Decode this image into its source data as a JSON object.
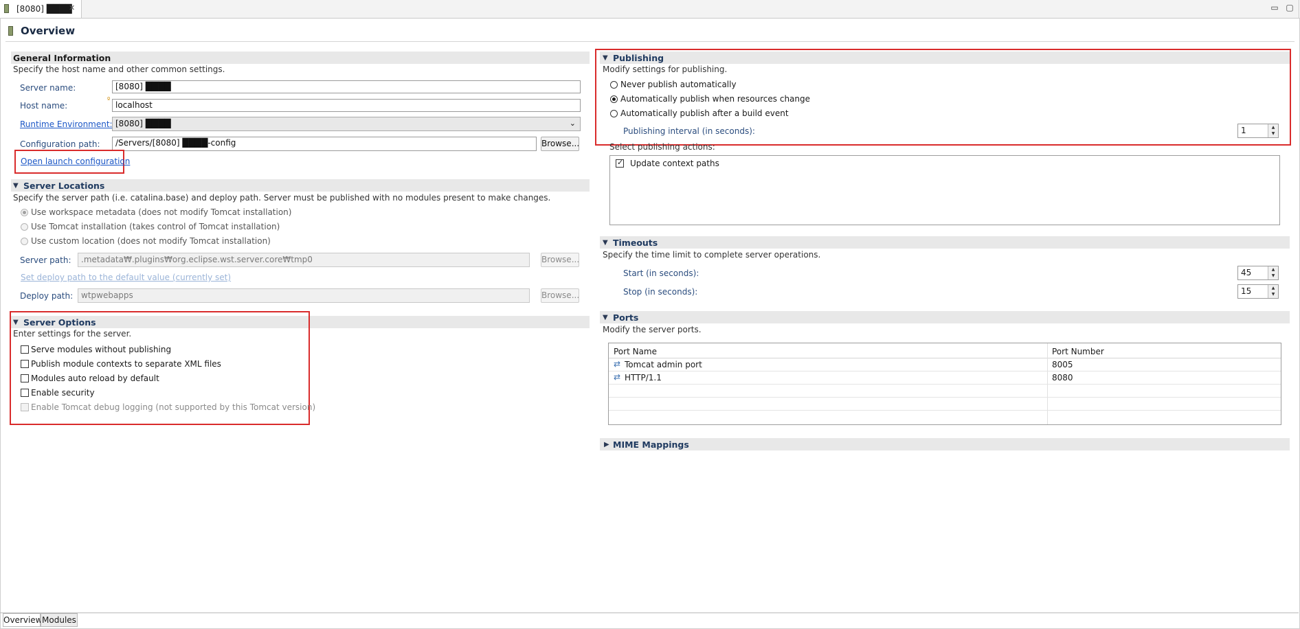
{
  "editor_tab": {
    "title": "[8080] ████"
  },
  "header": {
    "title": "Overview"
  },
  "general": {
    "title": "General Information",
    "description": "Specify the host name and other common settings.",
    "server_name_label": "Server name:",
    "server_name_value": "[8080] ████",
    "host_name_label": "Host name:",
    "host_name_value": "localhost",
    "runtime_label": "Runtime Environment:",
    "runtime_value": "[8080] ████",
    "config_label": "Configuration path:",
    "config_value": "/Servers/[8080] ████-config",
    "browse_label": "Browse...",
    "open_launch": "Open launch configuration"
  },
  "locations": {
    "title": "Server Locations",
    "description": "Specify the server path (i.e. catalina.base) and deploy path. Server must be published with no modules present to make changes.",
    "options": [
      {
        "label": "Use workspace metadata (does not modify Tomcat installation)",
        "selected": true
      },
      {
        "label": "Use Tomcat installation (takes control of Tomcat installation)",
        "selected": false
      },
      {
        "label": "Use custom location (does not modify Tomcat installation)",
        "selected": false
      }
    ],
    "server_path_label": "Server path:",
    "server_path_value": ".metadata₩.plugins₩org.eclipse.wst.server.core₩tmp0",
    "browse_label": "Browse...",
    "set_deploy_link": "Set deploy path to the default value (currently set)",
    "deploy_path_label": "Deploy path:",
    "deploy_path_value": "wtpwebapps"
  },
  "server_options": {
    "title": "Server Options",
    "description": "Enter settings for the server.",
    "items": [
      {
        "label": "Serve modules without publishing",
        "checked": false,
        "enabled": true
      },
      {
        "label": "Publish module contexts to separate XML files",
        "checked": false,
        "enabled": true
      },
      {
        "label": "Modules auto reload by default",
        "checked": false,
        "enabled": true
      },
      {
        "label": "Enable security",
        "checked": false,
        "enabled": true
      },
      {
        "label": "Enable Tomcat debug logging (not supported by this Tomcat version)",
        "checked": false,
        "enabled": false
      }
    ]
  },
  "publishing": {
    "title": "Publishing",
    "description": "Modify settings for publishing.",
    "options": [
      {
        "label": "Never publish automatically",
        "selected": false
      },
      {
        "label": "Automatically publish when resources change",
        "selected": true
      },
      {
        "label": "Automatically publish after a build event",
        "selected": false
      }
    ],
    "interval_label": "Publishing interval (in seconds):",
    "interval_value": "1",
    "actions_label": "Select publishing actions:",
    "actions": [
      {
        "label": "Update context paths",
        "checked": true
      }
    ]
  },
  "timeouts": {
    "title": "Timeouts",
    "description": "Specify the time limit to complete server operations.",
    "start_label": "Start (in seconds):",
    "start_value": "45",
    "stop_label": "Stop (in seconds):",
    "stop_value": "15"
  },
  "ports": {
    "title": "Ports",
    "description": "Modify the server ports.",
    "columns": [
      "Port Name",
      "Port Number"
    ],
    "rows": [
      {
        "name": "Tomcat admin port",
        "number": "8005"
      },
      {
        "name": "HTTP/1.1",
        "number": "8080"
      }
    ]
  },
  "mime": {
    "title": "MIME Mappings"
  },
  "bottom_tabs": [
    "Overview",
    "Modules"
  ],
  "colors": {
    "highlight": "#d92b2b",
    "link": "#1a56c6",
    "section_title": "#1f3a60"
  }
}
